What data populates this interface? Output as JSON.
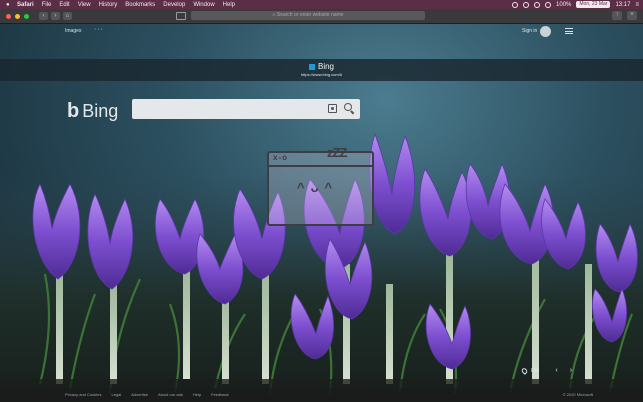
{
  "menubar": {
    "app": "Safari",
    "items": [
      "File",
      "Edit",
      "View",
      "History",
      "Bookmarks",
      "Develop",
      "Window",
      "Help"
    ],
    "battery": "100%",
    "date": "Mon, 23 Mar",
    "time": "13:17"
  },
  "toolbar": {
    "url_placeholder": "Search or enter website name"
  },
  "bing": {
    "images_link": "Images",
    "more_dots": "···",
    "sign_in": "Sign in",
    "logo_text": "Bing",
    "search_placeholder": ""
  },
  "banner": {
    "title": "Bing",
    "url": "https://www.bing.com/#"
  },
  "overlay": {
    "xo": "x-o",
    "zzz": "zZZ",
    "face": "^ᴗ^"
  },
  "info": {
    "label": "Info"
  },
  "footer": {
    "links": [
      "Privacy and Cookies",
      "Legal",
      "Advertise",
      "About our ads",
      "Help",
      "Feedback"
    ],
    "copyright": "© 2020 Microsoft"
  },
  "colors": {
    "menubar": "#5b2e47",
    "toolbar": "#3a3a3c",
    "bing_blue": "#1e9ad6",
    "crocus_purple": "#7a4fc9"
  }
}
